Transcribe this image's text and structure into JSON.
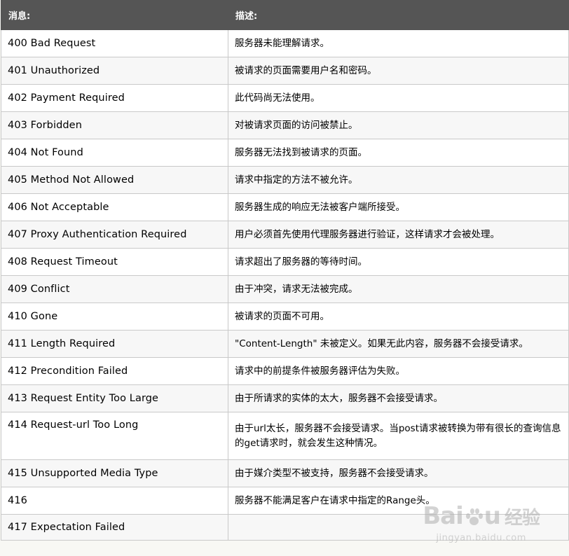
{
  "header": {
    "col_message": "消息:",
    "col_description": "描述:"
  },
  "rows": [
    {
      "message": "400 Bad Request",
      "description": "服务器未能理解请求。"
    },
    {
      "message": "401 Unauthorized",
      "description": "被请求的页面需要用户名和密码。"
    },
    {
      "message": "402 Payment Required",
      "description": "此代码尚无法使用。"
    },
    {
      "message": "403 Forbidden",
      "description": "对被请求页面的访问被禁止。"
    },
    {
      "message": "404 Not Found",
      "description": "服务器无法找到被请求的页面。"
    },
    {
      "message": "405 Method Not Allowed",
      "description": "请求中指定的方法不被允许。"
    },
    {
      "message": "406 Not Acceptable",
      "description": "服务器生成的响应无法被客户端所接受。"
    },
    {
      "message": "407 Proxy Authentication Required",
      "description": "用户必须首先使用代理服务器进行验证，这样请求才会被处理。"
    },
    {
      "message": "408 Request Timeout",
      "description": "请求超出了服务器的等待时间。"
    },
    {
      "message": "409 Conflict",
      "description": "由于冲突，请求无法被完成。"
    },
    {
      "message": "410 Gone",
      "description": "被请求的页面不可用。"
    },
    {
      "message": "411 Length Required",
      "description": "\"Content-Length\" 未被定义。如果无此内容，服务器不会接受请求。"
    },
    {
      "message": "412 Precondition Failed",
      "description": "请求中的前提条件被服务器评估为失败。"
    },
    {
      "message": "413 Request Entity Too Large",
      "description": "由于所请求的实体的太大，服务器不会接受请求。"
    },
    {
      "message": "414 Request-url Too Long",
      "description": "由于url太长，服务器不会接受请求。当post请求被转换为带有很长的查询信息的get请求时，就会发生这种情况。"
    },
    {
      "message": "415 Unsupported Media Type",
      "description": "由于媒介类型不被支持，服务器不会接受请求。"
    },
    {
      "message": "416",
      "description": "服务器不能满足客户在请求中指定的Range头。"
    },
    {
      "message": "417 Expectation Failed",
      "description": ""
    }
  ],
  "watermark": {
    "brand_left": "Bai",
    "brand_right": "u",
    "brand_suffix": "经验",
    "url": "jingyan.baidu.com"
  }
}
